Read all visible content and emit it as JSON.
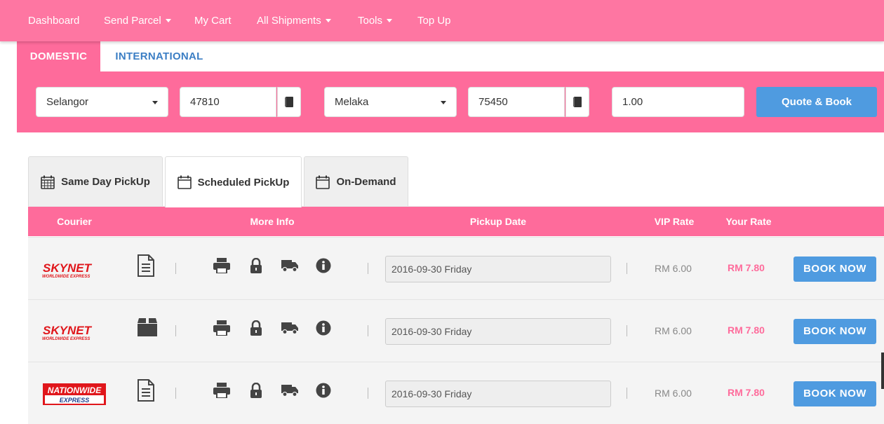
{
  "nav": {
    "items": [
      {
        "label": "Dashboard",
        "dropdown": false
      },
      {
        "label": "Send Parcel",
        "dropdown": true
      },
      {
        "label": "My Cart",
        "dropdown": false
      },
      {
        "label": "All Shipments",
        "dropdown": true
      },
      {
        "label": "Tools",
        "dropdown": true
      },
      {
        "label": "Top Up",
        "dropdown": false
      }
    ]
  },
  "quote": {
    "tabs": [
      "DOMESTIC",
      "INTERNATIONAL"
    ],
    "from_state": "Selangor",
    "from_postcode": "47810",
    "to_state": "Melaka",
    "to_postcode": "75450",
    "weight": "1.00",
    "submit_label": "Quote & Book"
  },
  "pickup_tabs": [
    "Same Day PickUp",
    "Scheduled PickUp",
    "On-Demand"
  ],
  "table": {
    "headers": {
      "courier": "Courier",
      "more_info": "More Info",
      "pickup_date": "Pickup Date",
      "vip_rate": "VIP Rate",
      "your_rate": "Your Rate"
    },
    "rows": [
      {
        "courier": "Skynet",
        "logo_top": "SKYNET",
        "logo_sub": "WORLDWIDE EXPRESS",
        "parcel_type": "document-icon",
        "pickup_date": "2016-09-30 Friday",
        "vip_rate": "RM 6.00",
        "your_rate": "RM 7.80",
        "action": "BOOK NOW"
      },
      {
        "courier": "Skynet",
        "logo_top": "SKYNET",
        "logo_sub": "WORLDWIDE EXPRESS",
        "parcel_type": "box-icon",
        "pickup_date": "2016-09-30 Friday",
        "vip_rate": "RM 6.00",
        "your_rate": "RM 7.80",
        "action": "BOOK NOW"
      },
      {
        "courier": "Nationwide Express",
        "logo_top": "NATIONWIDE",
        "logo_sub": "EXPRESS",
        "parcel_type": "document-icon",
        "pickup_date": "2016-09-30 Friday",
        "vip_rate": "RM 6.00",
        "your_rate": "RM 7.80",
        "action": "BOOK NOW"
      }
    ]
  },
  "colors": {
    "brand_pink": "#fe6b9b",
    "nav_pink": "#fe76a2",
    "button_blue": "#4f9be0",
    "tab_blue": "#3b7ec4"
  }
}
